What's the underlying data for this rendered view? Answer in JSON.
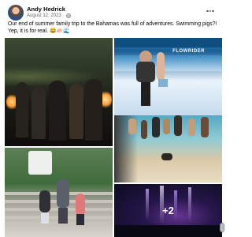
{
  "post": {
    "author": "Andy Hedrick",
    "date": "August 12, 2023",
    "separator": "·",
    "caption": "Our end of summer family trip to the Bahamas was full of adventures. Swimming pigs?! Yep, it is for real. 😂🐖🌊",
    "more_photos": "+2"
  },
  "photos": {
    "p2_sign": "FLOWRIDER"
  },
  "icons": {
    "audience": "globe-icon",
    "menu": "more-options-icon",
    "video": "volume-icon"
  }
}
